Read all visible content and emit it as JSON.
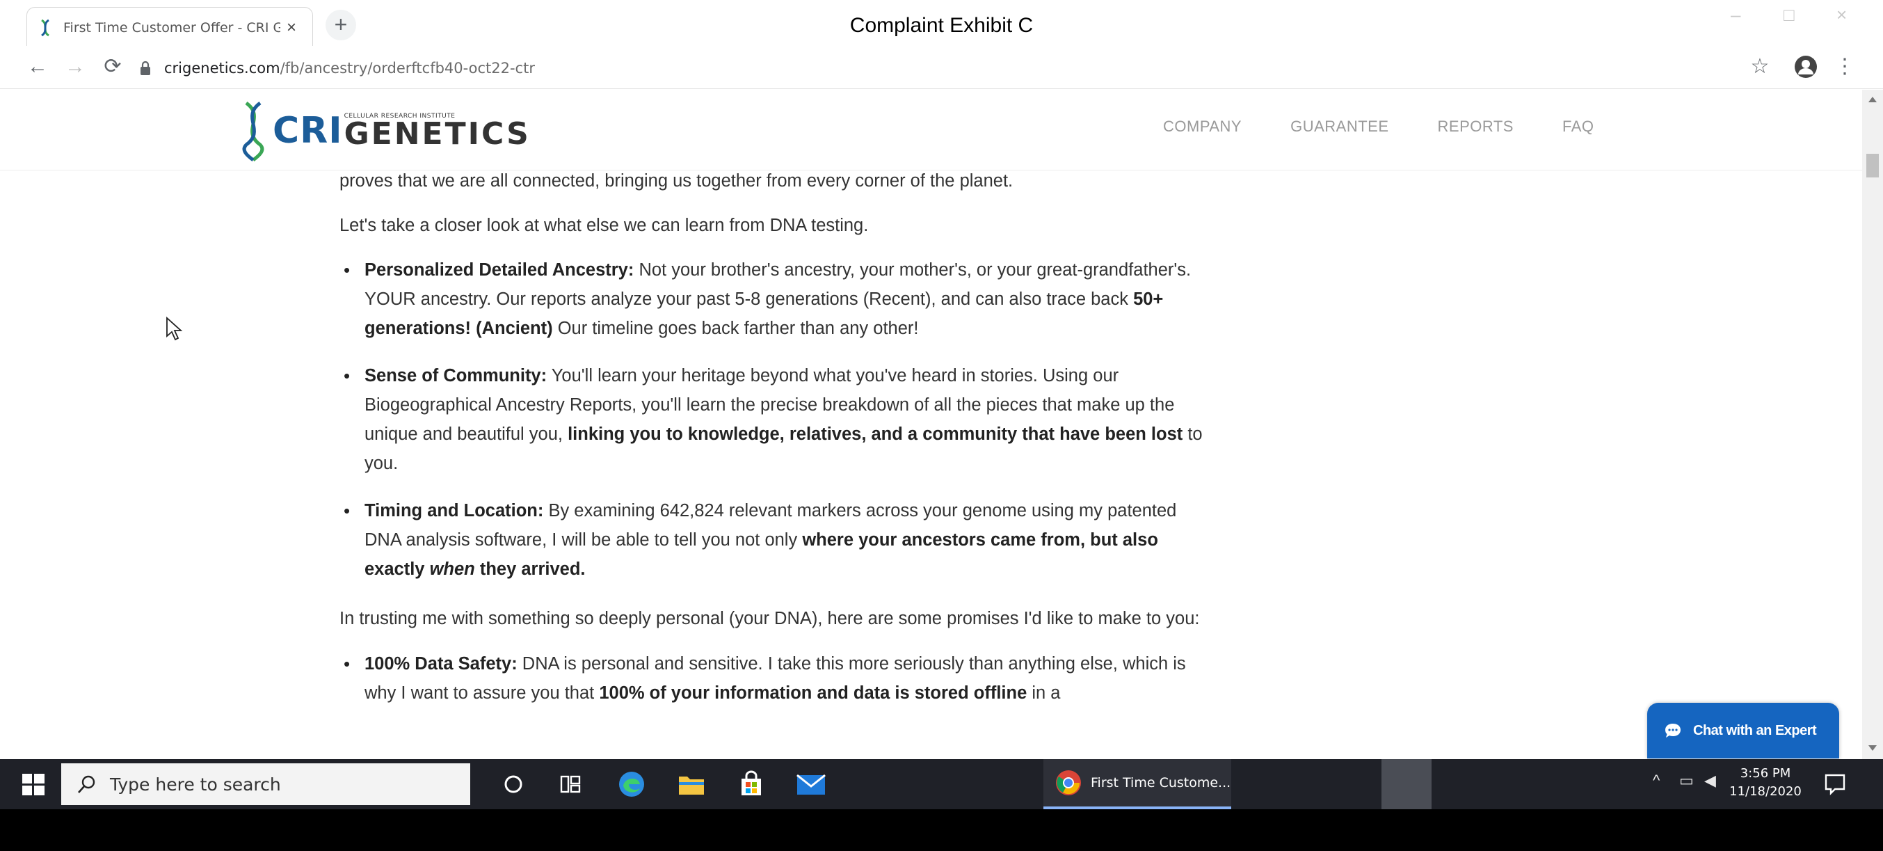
{
  "exhibit_label": "Complaint Exhibit C",
  "browser": {
    "tab_title": "First Time Customer Offer - CRI G",
    "url_host": "crigenetics.com",
    "url_path": "/fb/ancestry/orderftcfb40-oct22-ctr",
    "window_controls": [
      "–",
      "□",
      "×"
    ]
  },
  "site": {
    "logo_mark": "CRI",
    "logo_small": "CELLULAR RESEARCH INSTITUTE",
    "logo_word": "GENETICS",
    "nav": [
      "COMPANY",
      "GUARANTEE",
      "REPORTS",
      "FAQ"
    ]
  },
  "article": {
    "intro_fragment": "proves that we are all connected, bringing us together from every corner of the planet.",
    "lead": "Let's take a closer look at what else we can learn from DNA testing.",
    "bullets": [
      {
        "head": "Personalized Detailed Ancestry:",
        "t1": " Not your brother's ancestry, your mother's, or your great-grandfather's. YOUR ancestry. Our reports analyze your past 5-8 generations (Recent), and can also trace back ",
        "b1": "50+ generations! (Ancient)",
        "t2": " Our timeline goes back farther than any other!"
      },
      {
        "head": "Sense of Community:",
        "t1": " You'll learn your heritage beyond what you've heard in stories. Using our Biogeographical Ancestry Reports, you'll learn the precise breakdown of all the pieces that make up the unique and beautiful you, ",
        "b1": "linking you to knowledge, relatives, and a community that have been lost",
        "t2": " to you."
      },
      {
        "head": "Timing and Location:",
        "t1": " By examining 642,824 relevant markers across your genome using my patented DNA analysis software, I will be able to tell you not only ",
        "b1": "where your ancestors came from, but also exactly ",
        "i1": "when",
        "b2": "  they arrived."
      }
    ],
    "promise_intro": "In trusting me with something so deeply personal (your DNA), here are some promises I'd like to make to you:",
    "safety": {
      "head": "100% Data Safety:",
      "t1": " DNA is personal and sensitive. I take this more seriously than anything else, which is why I want to assure you that ",
      "b1": "100% of your information and data is stored offline",
      "t2": " in a"
    }
  },
  "chat_button": "Chat with an Expert",
  "taskbar": {
    "search_placeholder": "Type here to search",
    "chrome_task_label": "First Time Custome...",
    "time": "3:56 PM",
    "date": "11/18/2020"
  },
  "colors": {
    "brand_blue": "#1c5d99",
    "chat_blue": "#1565c0",
    "taskbar": "#1f2128",
    "nav_gray": "#9a9a9a"
  }
}
